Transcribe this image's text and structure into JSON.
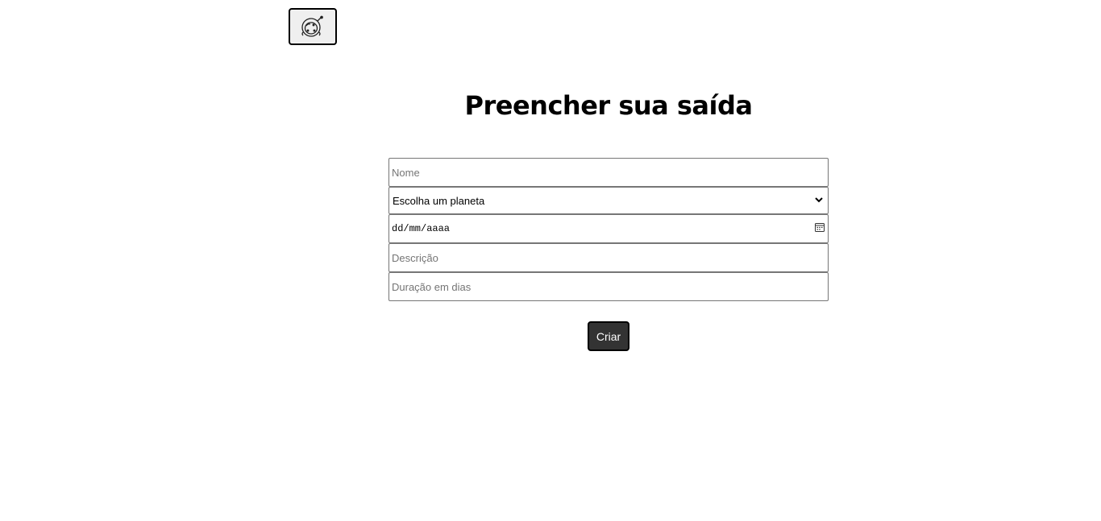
{
  "header": {
    "logo_icon": "astronaut-helmet-icon"
  },
  "main": {
    "title": "Preencher sua saída"
  },
  "form": {
    "name_placeholder": "Nome",
    "planet_select_value": "Escolha um planeta",
    "date_value": "dd/mm/aaaa",
    "date_icon": "calendar-icon",
    "description_placeholder": "Descrição",
    "duration_placeholder": "Duração em dias",
    "submit_label": "Criar"
  },
  "colors": {
    "button_bg": "#333333",
    "button_text": "#ffffff",
    "logo_button_bg": "#efefef",
    "field_border": "#767676"
  }
}
